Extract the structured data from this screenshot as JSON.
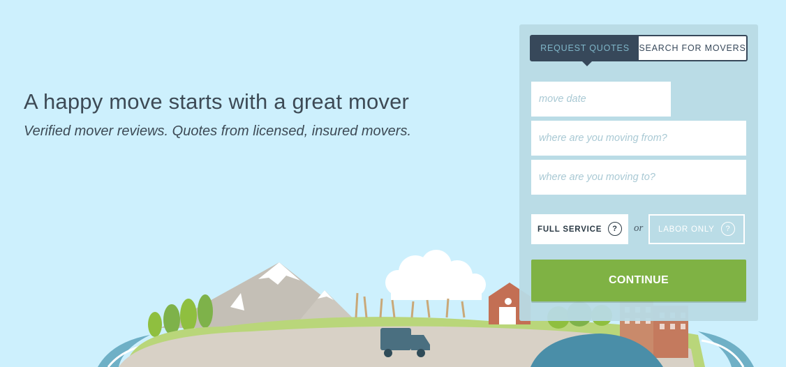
{
  "hero": {
    "headline": "A happy move starts with a great mover",
    "subheadline": "Verified mover reviews. Quotes from licensed, insured movers."
  },
  "form": {
    "tabs": [
      {
        "label": "REQUEST QUOTES",
        "active": true
      },
      {
        "label": "SEARCH FOR MOVERS",
        "active": false
      }
    ],
    "move_date_placeholder": "move date",
    "moving_from_placeholder": "where are you moving from?",
    "moving_to_placeholder": "where are you moving to?",
    "full_service_label": "FULL SERVICE",
    "or_label": "or",
    "labor_only_label": "LABOR ONLY",
    "help_glyph": "?",
    "continue_label": "CONTINUE"
  },
  "colors": {
    "background": "#cdf0fd",
    "panel": "#b8dae5",
    "tab_active": "#37485a",
    "continue_button": "#7fb244"
  },
  "icons": [
    "help-icon",
    "truck-icon"
  ]
}
